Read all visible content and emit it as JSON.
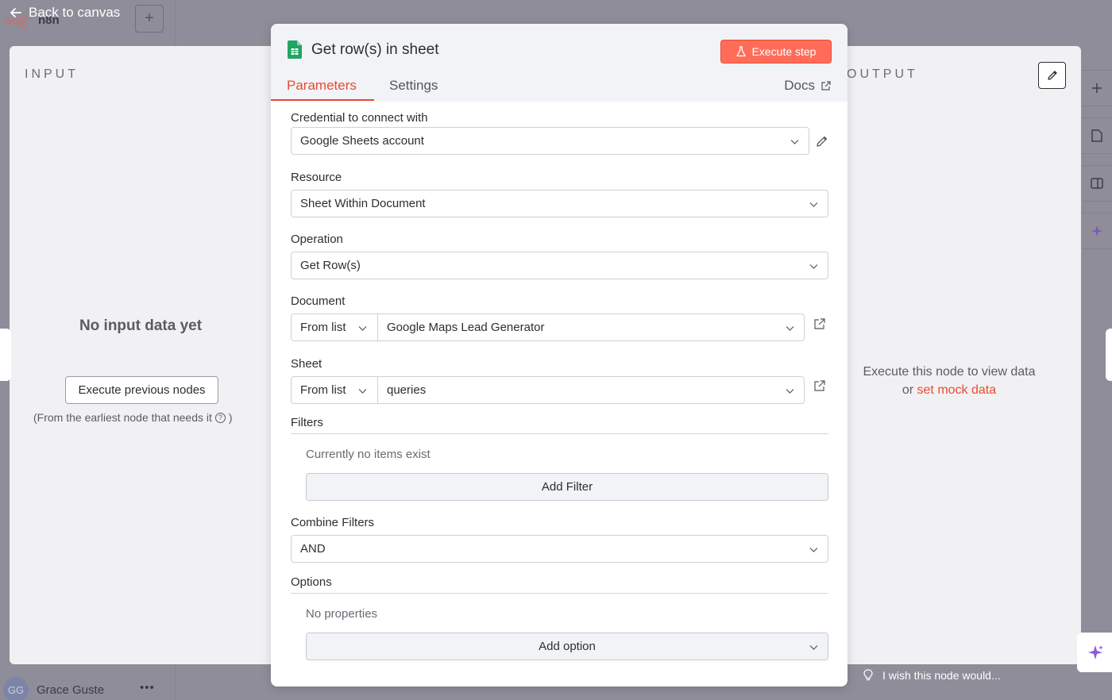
{
  "background": {
    "logo_text": "n8n",
    "back_label": "Back to canvas",
    "plus_label": "+",
    "user_initials": "GG",
    "user_name": "Grace Guste",
    "user_menu": "•••"
  },
  "input_panel": {
    "title": "INPUT",
    "empty_message": "No input data yet",
    "execute_previous_label": "Execute previous nodes",
    "hint": "(From the earliest node that needs it",
    "hint_help": "?",
    "hint_close": ")"
  },
  "output_panel": {
    "title": "OUTPUT",
    "message_line1": "Execute this node to view data",
    "message_or": "or",
    "mock_link": "set mock data",
    "wish_text": "I wish this node would..."
  },
  "node": {
    "title": "Get row(s) in sheet",
    "execute_label": "Execute step",
    "tabs": {
      "parameters": "Parameters",
      "settings": "Settings",
      "active": "parameters"
    },
    "docs_label": "Docs",
    "accent": "#ea4b31",
    "execute_color": "#ff6d5a"
  },
  "fields": {
    "credential": {
      "label": "Credential to connect with",
      "value": "Google Sheets account"
    },
    "resource": {
      "label": "Resource",
      "value": "Sheet Within Document"
    },
    "operation": {
      "label": "Operation",
      "value": "Get Row(s)"
    },
    "document": {
      "label": "Document",
      "mode": "From list",
      "value": "Google Maps Lead Generator"
    },
    "sheet": {
      "label": "Sheet",
      "mode": "From list",
      "value": "queries"
    },
    "filters": {
      "label": "Filters",
      "empty": "Currently no items exist",
      "add_label": "Add Filter"
    },
    "combine": {
      "label": "Combine Filters",
      "value": "AND"
    },
    "options": {
      "label": "Options",
      "empty": "No properties",
      "add_label": "Add option"
    }
  }
}
